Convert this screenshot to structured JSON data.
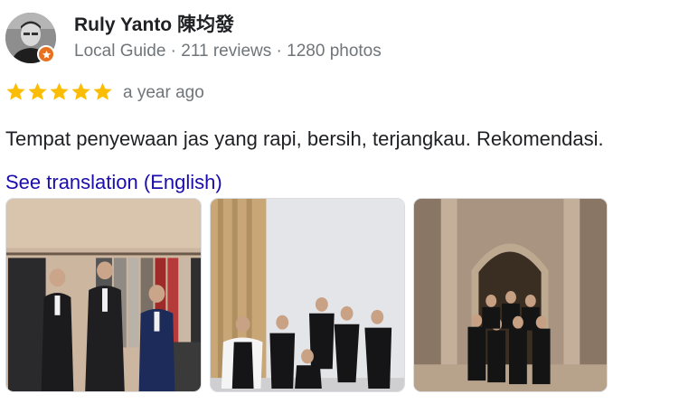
{
  "author": {
    "name": "Ruly Yanto 陳均發",
    "meta": "Local Guide · 211 reviews · 1280 photos",
    "avatar_icon": "person-avatar-icon",
    "badge_icon": "local-guide-star-icon"
  },
  "rating": {
    "stars": 5,
    "time_ago": "a year ago",
    "star_color": "#fbbc04"
  },
  "review": {
    "text": "Tempat penyewaan jas yang rapi, bersih, terjangkau. Rekomendasi.",
    "translate_link": "See translation (English)"
  },
  "photos": [
    {
      "subject": "suit-rental-store-photo"
    },
    {
      "subject": "studio-group-photo"
    },
    {
      "subject": "arch-building-group-photo"
    }
  ],
  "colors": {
    "link": "#1a0dab",
    "secondary_text": "#70757a",
    "primary_text": "#202124",
    "badge": "#e8711f"
  }
}
